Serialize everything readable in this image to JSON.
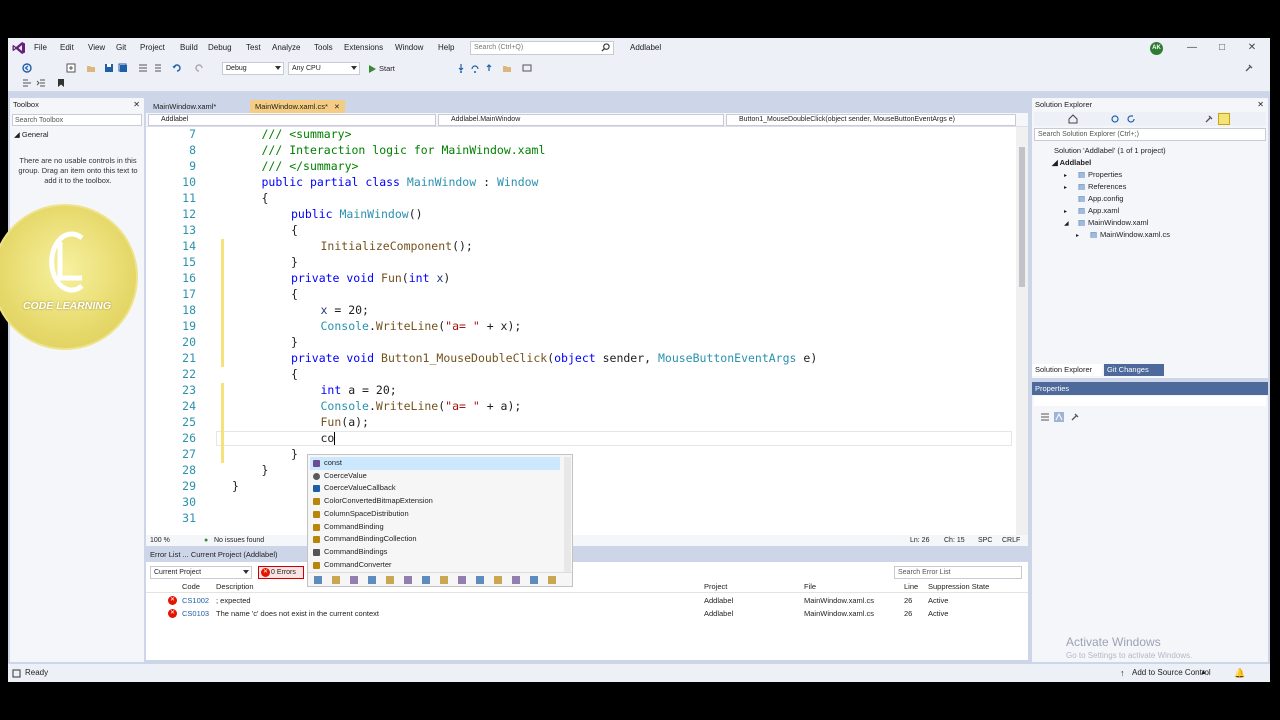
{
  "menubar": {
    "items": [
      "File",
      "Edit",
      "View",
      "Git",
      "Project",
      "Build",
      "Debug",
      "Test",
      "Analyze",
      "Tools",
      "Extensions",
      "Window",
      "Help"
    ],
    "search_placeholder": "Search (Ctrl+Q)",
    "app_name": "Addlabel",
    "avatar": "AK"
  },
  "toolbar": {
    "config": "Debug",
    "platform": "Any CPU",
    "start_label": "Start"
  },
  "toolbox": {
    "title": "Toolbox",
    "search_placeholder": "Search Toolbox",
    "group": "General",
    "empty_text": "There are no usable controls in this group. Drag an item onto this text to add it to the toolbox."
  },
  "editor": {
    "tabs": [
      {
        "label": "MainWindow.xaml*",
        "active": false
      },
      {
        "label": "MainWindow.xaml.cs*",
        "active": true
      }
    ],
    "nav": [
      "Addlabel",
      "Addlabel.MainWindow",
      "Button1_MouseDoubleClick(object sender, MouseButtonEventArgs e)"
    ],
    "line_numbers": [
      "7",
      "8",
      "9",
      "10",
      "11",
      "12",
      "13",
      "14",
      "15",
      "16",
      "17",
      "18",
      "19",
      "20",
      "21",
      "22",
      "23",
      "24",
      "25",
      "26",
      "27",
      "28",
      "29",
      "30",
      "31"
    ],
    "zoom": "100 %",
    "issues": "No issues found",
    "ln": "Ln: 26",
    "ch": "Ch: 15",
    "spc": "SPC",
    "crlf": "CRLF"
  },
  "code": {
    "l7": "/// <summary>",
    "l8": "/// Interaction logic for MainWindow.xaml",
    "l9": "/// </summary>",
    "l10_a": "public partial class ",
    "l10_b": "MainWindow",
    "l10_c": " : ",
    "l10_d": "Window",
    "l11": "{",
    "l12_a": "public ",
    "l12_b": "MainWindow",
    "l12_c": "()",
    "l13": "{",
    "l14_a": "InitializeComponent",
    "l14_b": "();",
    "l15": "}",
    "l16_a": "private void ",
    "l16_b": "Fun",
    "l16_c": "(",
    "l16_d": "int ",
    "l16_e": "x",
    "l16_f": ")",
    "l17": "{",
    "l18_a": "x",
    "l18_b": " = 20;",
    "l19_a": "Console",
    "l19_b": ".",
    "l19_c": "WriteLine",
    "l19_d": "(",
    "l19_e": "\"a= \"",
    "l19_f": " + x);",
    "l20": "}",
    "l21_a": "private void ",
    "l21_b": "Button1_MouseDoubleClick",
    "l21_c": "(",
    "l21_d": "object ",
    "l21_e": "sender, ",
    "l21_f": "MouseButtonEventArgs ",
    "l21_g": "e)",
    "l22": "{",
    "l23_a": "int ",
    "l23_b": "a = 20;",
    "l24_a": "Console",
    "l24_b": ".",
    "l24_c": "WriteLine",
    "l24_d": "(",
    "l24_e": "\"a= \"",
    "l24_f": " + a);",
    "l25_a": "Fun",
    "l25_b": "(a);",
    "l26": "co",
    "l27": "}",
    "l28": "}",
    "l29": "}"
  },
  "autocomplete": {
    "items": [
      "const",
      "CoerceValue",
      "CoerceValueCallback",
      "ColorConvertedBitmapExtension",
      "ColumnSpaceDistribution",
      "CommandBinding",
      "CommandBindingCollection",
      "CommandBindings",
      "CommandConverter"
    ]
  },
  "errorlist": {
    "title": "Error List ... Current Project (Addlabel)",
    "scope": "Current Project",
    "errors_badge": "0 Errors",
    "search_placeholder": "Search Error List",
    "columns": {
      "code": "Code",
      "description": "Description",
      "project": "Project",
      "file": "File",
      "line": "Line",
      "state": "Suppression State"
    },
    "rows": [
      {
        "code": "CS1002",
        "description": "; expected",
        "project": "Addlabel",
        "file": "MainWindow.xaml.cs",
        "line": "26",
        "state": "Active"
      },
      {
        "code": "CS0103",
        "description": "The name 'c' does not exist in the current context",
        "project": "Addlabel",
        "file": "MainWindow.xaml.cs",
        "line": "26",
        "state": "Active"
      }
    ]
  },
  "solution": {
    "title": "Solution Explorer",
    "search_placeholder": "Search Solution Explorer (Ctrl+;)",
    "root": "Solution 'Addlabel' (1 of 1 project)",
    "project": "Addlabel",
    "items": [
      "Properties",
      "References",
      "App.config",
      "App.xaml",
      "MainWindow.xaml",
      "MainWindow.xaml.cs"
    ],
    "tab1": "Solution Explorer",
    "tab2": "Git Changes"
  },
  "properties": {
    "title": "Properties"
  },
  "status": {
    "ready": "Ready",
    "source": "Add to Source Control"
  },
  "watermark": {
    "brand": "CODE LEARNING",
    "activate": "Activate Windows",
    "activate_sub": "Go to Settings to activate Windows."
  },
  "colors": {
    "accent": "#007acc",
    "error": "#e51400",
    "vs_purple": "#68217a"
  }
}
